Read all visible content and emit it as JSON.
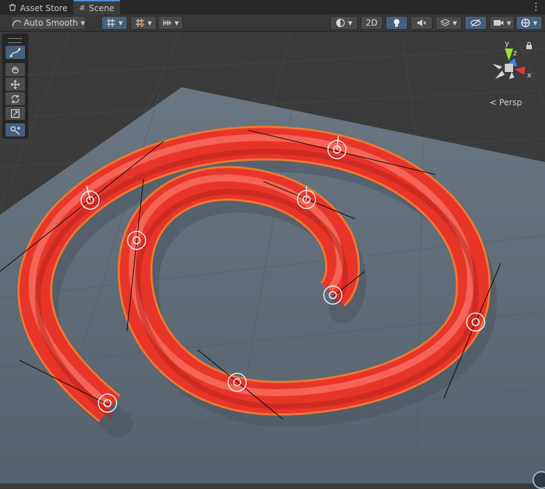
{
  "tabs": [
    {
      "label": "Asset Store",
      "icon": "asset-store-icon"
    },
    {
      "label": "Scene",
      "icon": "scene-grid-icon"
    }
  ],
  "toolbar": {
    "tool_mode_label": "Auto Smooth",
    "twod_label": "2D"
  },
  "view": {
    "projection_label": "Persp",
    "gizmo_axes": {
      "x": "x",
      "y": "y",
      "z": "z"
    }
  },
  "colors": {
    "accent": "#46607c",
    "spline": "#e8352a",
    "spline_outline": "#f07830",
    "floor": "#5d6a75",
    "background": "#3a3a3a"
  }
}
